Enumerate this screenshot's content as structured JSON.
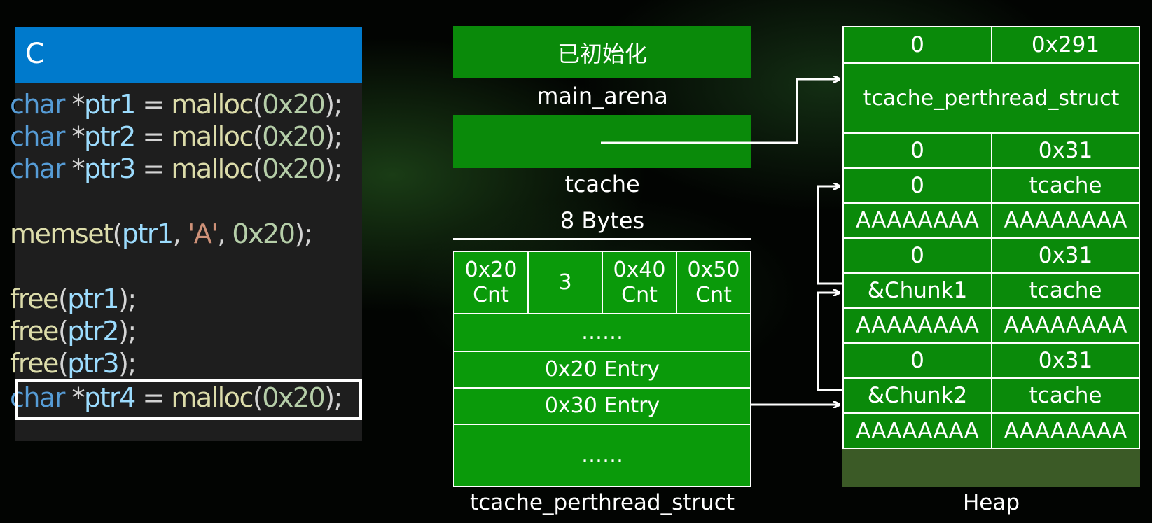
{
  "code": {
    "title": "C",
    "lines": [
      {
        "kw": "char",
        "rest1": " *",
        "var": "ptr1",
        "rest2": " = ",
        "fn": "malloc",
        "p1": "(",
        "num": "0x20",
        "p2": ");"
      },
      {
        "kw": "char",
        "rest1": " *",
        "var": "ptr2",
        "rest2": " = ",
        "fn": "malloc",
        "p1": "(",
        "num": "0x20",
        "p2": ");"
      },
      {
        "kw": "char",
        "rest1": " *",
        "var": "ptr3",
        "rest2": " = ",
        "fn": "malloc",
        "p1": "(",
        "num": "0x20",
        "p2": ");"
      }
    ],
    "memset": {
      "fn": "memset",
      "p1": "(",
      "var": "ptr1",
      "c1": ", ",
      "str": "'A'",
      "c2": ", ",
      "num": "0x20",
      "p2": ");"
    },
    "frees": [
      {
        "fn": "free",
        "p1": "(",
        "var": "ptr1",
        "p2": ");"
      },
      {
        "fn": "free",
        "p1": "(",
        "var": "ptr2",
        "p2": ");"
      },
      {
        "fn": "free",
        "p1": "(",
        "var": "ptr3",
        "p2": ");"
      }
    ],
    "last": {
      "kw": "char",
      "rest1": " *",
      "var": "ptr4",
      "rest2": " = ",
      "fn": "malloc",
      "p1": "(",
      "num": "0x20",
      "p2": ");"
    }
  },
  "arena": {
    "initialized": "已初始化",
    "main_arena": "main_arena",
    "tcache": "tcache",
    "bytes": "8 Bytes"
  },
  "tstruct": {
    "cnt_cells": [
      {
        "top": "0x20",
        "bottom": "Cnt"
      },
      {
        "top": "3",
        "bottom": ""
      },
      {
        "top": "0x40",
        "bottom": "Cnt"
      },
      {
        "top": "0x50",
        "bottom": "Cnt"
      }
    ],
    "dots1": "……",
    "entry20": "0x20 Entry",
    "entry30": "0x30 Entry",
    "dots2": "……",
    "caption": "tcache_perthread_struct"
  },
  "heap": {
    "row0": [
      "0",
      "0x291"
    ],
    "tps": "tcache_perthread_struct",
    "rows": [
      [
        "0",
        "0x31"
      ],
      [
        "0",
        "tcache"
      ],
      [
        "AAAAAAAA",
        "AAAAAAAA"
      ],
      [
        "0",
        "0x31"
      ],
      [
        "&Chunk1",
        "tcache"
      ],
      [
        "AAAAAAAA",
        "AAAAAAAA"
      ],
      [
        "0",
        "0x31"
      ],
      [
        "&Chunk2",
        "tcache"
      ],
      [
        "AAAAAAAA",
        "AAAAAAAA"
      ]
    ],
    "caption": "Heap"
  },
  "colors": {
    "code_bg": "#1e1e1e",
    "header": "#007acc",
    "green": "#0a8a0a",
    "keyword": "#569cd6",
    "variable": "#9cdcfe",
    "function": "#dcdcaa",
    "number": "#b5cea8",
    "string": "#ce9178"
  }
}
